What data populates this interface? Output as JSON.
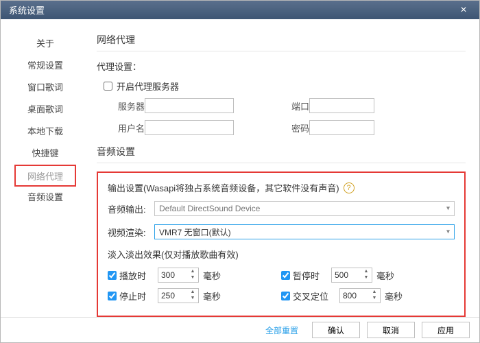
{
  "title": "系统设置",
  "sidebar": {
    "items": [
      {
        "label": "关于"
      },
      {
        "label": "常规设置"
      },
      {
        "label": "窗口歌词"
      },
      {
        "label": "桌面歌词"
      },
      {
        "label": "本地下载"
      },
      {
        "label": "快捷键"
      },
      {
        "label": "网络代理"
      },
      {
        "label": "音频设置"
      }
    ]
  },
  "network": {
    "section_title": "网络代理",
    "proxy_label": "代理设置：",
    "enable_proxy": "开启代理服务器",
    "server_label": "服务器",
    "server_value": "",
    "port_label": "端口",
    "port_value": "",
    "user_label": "用户名",
    "user_value": "",
    "pass_label": "密码",
    "pass_value": ""
  },
  "audio": {
    "section_title": "音频设置",
    "output_hint": "输出设置(Wasapi将独占系统音频设备，其它软件没有声音)",
    "help_icon": "?",
    "audio_out_label": "音频输出:",
    "audio_out_value": "Default DirectSound Device",
    "video_render_label": "视频渲染:",
    "video_render_value": "VMR7 无窗口(默认)",
    "fade_title": "淡入淡出效果(仅对播放歌曲有效)",
    "fade": {
      "play_label": "播放时",
      "play_value": "300",
      "pause_label": "暂停时",
      "pause_value": "500",
      "stop_label": "停止时",
      "stop_value": "250",
      "cross_label": "交叉定位",
      "cross_value": "800",
      "unit": "毫秒"
    }
  },
  "footer": {
    "reset": "全部重置",
    "ok": "确认",
    "cancel": "取消",
    "apply": "应用"
  }
}
